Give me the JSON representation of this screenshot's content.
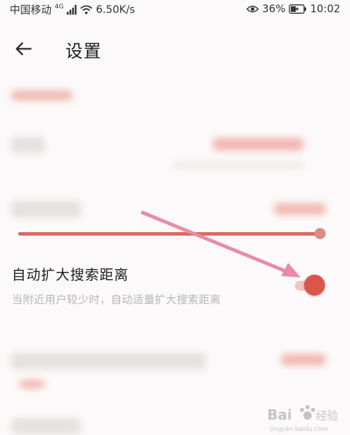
{
  "status_bar": {
    "carrier": "中国移动",
    "network_type": "4G",
    "net_speed": "6.50K/s",
    "battery": "36%",
    "time": "10:02"
  },
  "header": {
    "title": "设置"
  },
  "focused_setting": {
    "title": "自动扩大搜索距离",
    "description": "当附近用户较少时，自动适量扩大搜索距离",
    "toggle_on": true
  },
  "slider": {
    "level": 1.0
  },
  "colors": {
    "accent": "#d8564b",
    "accent_light": "#f2c5c0",
    "slider": "#d86a63",
    "arrow": "#e98aa8"
  },
  "icons": [
    "back-arrow-icon",
    "signal-icon",
    "wifi-icon",
    "eye-icon",
    "battery-icon"
  ]
}
